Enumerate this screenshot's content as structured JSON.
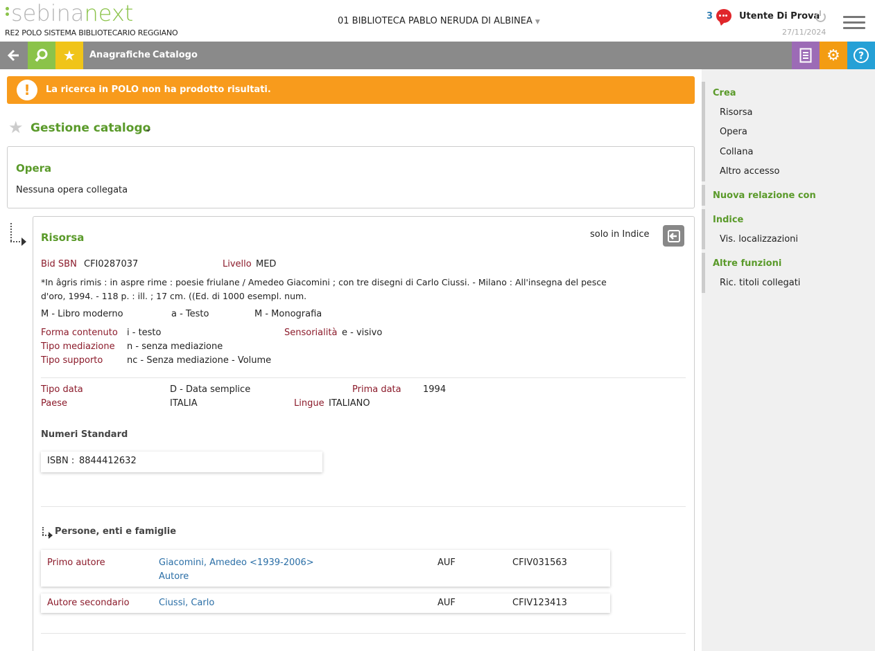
{
  "header": {
    "logo_part1": "sebina",
    "logo_part2": "next",
    "polo": "RE2 POLO SISTEMA BIBLIOTECARIO REGGIANO",
    "library": "01 BIBLIOTECA PABLO NERUDA DI ALBINEA",
    "message_count": "3",
    "user": "Utente Di Prova",
    "date": "27/11/2024"
  },
  "toolbar": {
    "nav": [
      "Anagrafiche",
      "Catalogo"
    ]
  },
  "alert": {
    "text": "La ricerca in POLO non ha prodotto risultati."
  },
  "page": {
    "title": "Gestione catalogo"
  },
  "opera": {
    "title": "Opera",
    "empty": "Nessuna opera collegata"
  },
  "risorsa": {
    "title": "Risorsa",
    "scope": "solo in Indice",
    "bid_label": "Bid SBN",
    "bid_value": "CFI0287037",
    "livello_label": "Livello",
    "livello_value": "MED",
    "description_line1": "*In âgris rimis : in aspre rime : poesie friulane / Amedeo Giacomini ; con tre disegni di Carlo Ciussi. - Milano : All'insegna del pesce",
    "description_line2": "d'oro, 1994. - 118 p. : ill. ; 17 cm. ((Ed. di 1000 esempl. num.",
    "type1": "M - Libro moderno",
    "type2": "a - Testo",
    "type3": "M - Monografia",
    "forma_label": "Forma contenuto",
    "forma_value": "i - testo",
    "sensorialita_label": "Sensorialità",
    "sensorialita_value": "e - visivo",
    "mediazione_label": "Tipo mediazione",
    "mediazione_value": "n - senza mediazione",
    "supporto_label": "Tipo supporto",
    "supporto_value": "nc - Senza mediazione - Volume",
    "tipo_data_label": "Tipo data",
    "tipo_data_value": "D - Data semplice",
    "prima_data_label": "Prima data",
    "prima_data_value": "1994",
    "paese_label": "Paese",
    "paese_value": "ITALIA",
    "lingue_label": "Lingue",
    "lingue_value": "ITALIANO",
    "numeri_title": "Numeri Standard",
    "isbn_label": "ISBN :",
    "isbn_value": "8844412632",
    "persone_title": "Persone, enti e famiglie",
    "authors": [
      {
        "role": "Primo autore",
        "name": "Giacomini, Amedeo <1939-2006>",
        "sub": "Autore",
        "type": "AUF",
        "code": "CFIV031563"
      },
      {
        "role": "Autore secondario",
        "name": "Ciussi, Carlo",
        "sub": "",
        "type": "AUF",
        "code": "CFIV123413"
      }
    ]
  },
  "sidebar": {
    "crea": "Crea",
    "crea_items": [
      "Risorsa",
      "Opera",
      "Collana",
      "Altro accesso"
    ],
    "nuova": "Nuova relazione con",
    "indice": "Indice",
    "indice_items": [
      "Vis. localizzazioni"
    ],
    "altre": "Altre funzioni",
    "altre_items": [
      "Ric. titoli collegati"
    ]
  },
  "colors": {
    "green": "#8bc34a",
    "orange": "#f89b1c",
    "label_red": "#8b1a2a",
    "link_blue": "#2a6ea6"
  }
}
